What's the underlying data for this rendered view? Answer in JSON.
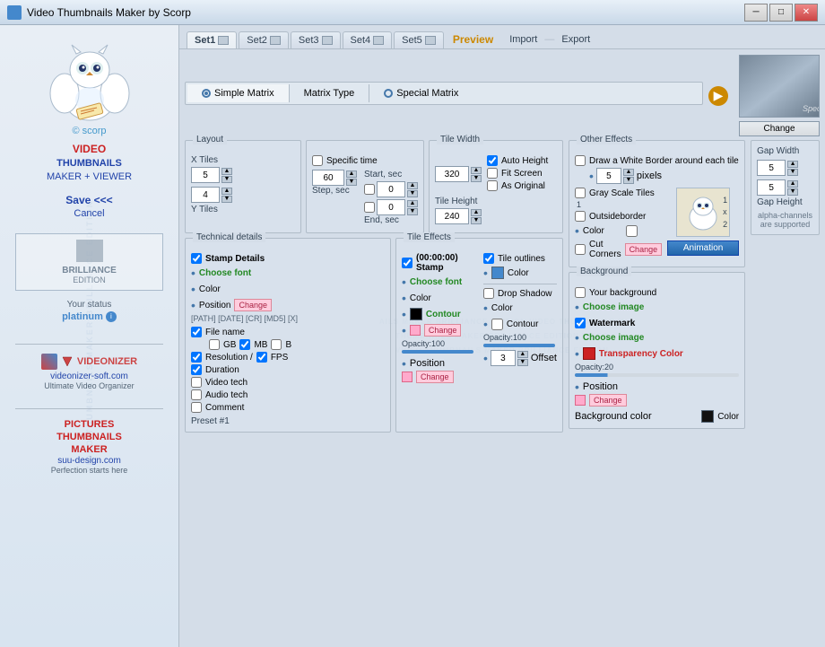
{
  "window": {
    "title": "Video Thumbnails Maker by Scorp"
  },
  "sidebar": {
    "scorp_credit": "© scorp",
    "app_title_video": "VIDEO",
    "app_title_thumbnails": "THUMBNAILS",
    "app_title_maker": "MAKER + VIEWER",
    "save_btn": "Save <<<",
    "cancel_btn": "Cancel",
    "edition_label": "BRILLIANCE",
    "edition_sub": "EDITION",
    "your_status": "Your status",
    "status_value": "platinum",
    "videonizer_label": "VIDEONIZER",
    "videonizer_link": "videonizer-soft.com",
    "videonizer_desc": "Ultimate Video Organizer",
    "pictures_title_line1": "PICTURES",
    "pictures_title_line2": "THUMBNAILS",
    "pictures_title_line3": "MAKER",
    "pictures_link": "suu-design.com",
    "pictures_desc": "Perfection starts here"
  },
  "tabs": {
    "set1": "Set1",
    "set2": "Set2",
    "set3": "Set3",
    "set4": "Set4",
    "set5": "Set5",
    "preview": "Preview",
    "import": "Import",
    "export": "Export"
  },
  "matrix_types": {
    "simple": "Simple Matrix",
    "type": "Matrix Type",
    "special": "Special Matrix"
  },
  "layout": {
    "label": "Layout",
    "x_tiles_label": "X Tiles",
    "x_tiles_value": "5",
    "y_tiles_label": "Y Tiles",
    "y_tiles_value": "4",
    "specific_time_label": "Specific time",
    "start_label": "Start, sec",
    "start_value": "0",
    "step_label": "Step, sec",
    "step_value": "60",
    "end_label": "End, sec",
    "end_value": "0",
    "tile_width_label": "Tile Width",
    "tile_width_value": "320",
    "tile_height_label": "Tile Height",
    "tile_height_value": "240",
    "auto_height": "Auto Height",
    "fit_screen": "Fit Screen",
    "as_original": "As Original"
  },
  "technical_details": {
    "label": "Technical details",
    "stamp_details": "Stamp Details",
    "choose_font": "Choose font",
    "color_label": "Color",
    "position_label": "Position",
    "change_label": "Change",
    "path_info": "[PATH] [DATE] [CR] [MD5] [X]",
    "preset_label": "Preset #1",
    "file_name": "File name",
    "gb_label": "GB",
    "mb_label": "MB",
    "b_label": "B",
    "resolution_label": "Resolution /",
    "fps_label": "FPS",
    "duration_label": "Duration",
    "video_tech": "Video tech",
    "audio_tech": "Audio tech",
    "comment_label": "Comment"
  },
  "other_effects": {
    "label": "Other Effects",
    "white_border": "Draw a White Border around each tile",
    "pixels_value": "5",
    "pixels_label": "pixels",
    "gray_scale": "Gray Scale Tiles",
    "outside_border": "Outsideborder",
    "color_label": "Color",
    "cut_corners": "Cut Corners",
    "change_label": "Change",
    "count_value": "1"
  },
  "animation": {
    "label": "Animation",
    "num1": "1",
    "num2": "x",
    "num3": "2"
  },
  "tile_effects": {
    "label": "Tile Effects",
    "stamp_label": "(00:00:00) Stamp",
    "choose_font": "Choose font",
    "color_label": "Color",
    "contour_label": "Contour",
    "change_label": "Change",
    "opacity_label": "Opacity:100",
    "position_label": "Position",
    "change2_label": "Change",
    "tile_outlines": "Tile outlines",
    "color2_label": "Color",
    "drop_shadow": "Drop Shadow",
    "color3_label": "Color",
    "contour2_label": "Contour",
    "opacity2_label": "Opacity:100",
    "offset_label": "3",
    "offset_text": "Offset"
  },
  "background": {
    "label": "Background",
    "your_background": "Your background",
    "choose_image": "Choose image",
    "watermark_label": "Watermark",
    "choose_image2": "Choose image",
    "transparency_color": "Transparency Color",
    "opacity_label": "Opacity:20",
    "position_label": "Position",
    "change_label": "Change",
    "bg_color_label": "Background color",
    "color_label": "Color"
  },
  "gap": {
    "width_label": "Gap Width",
    "height_label": "Gap Height",
    "width_value": "5",
    "height_value": "5",
    "alpha_note": "alpha-channels are supported"
  },
  "preview": {
    "spec_text": "Spec"
  }
}
